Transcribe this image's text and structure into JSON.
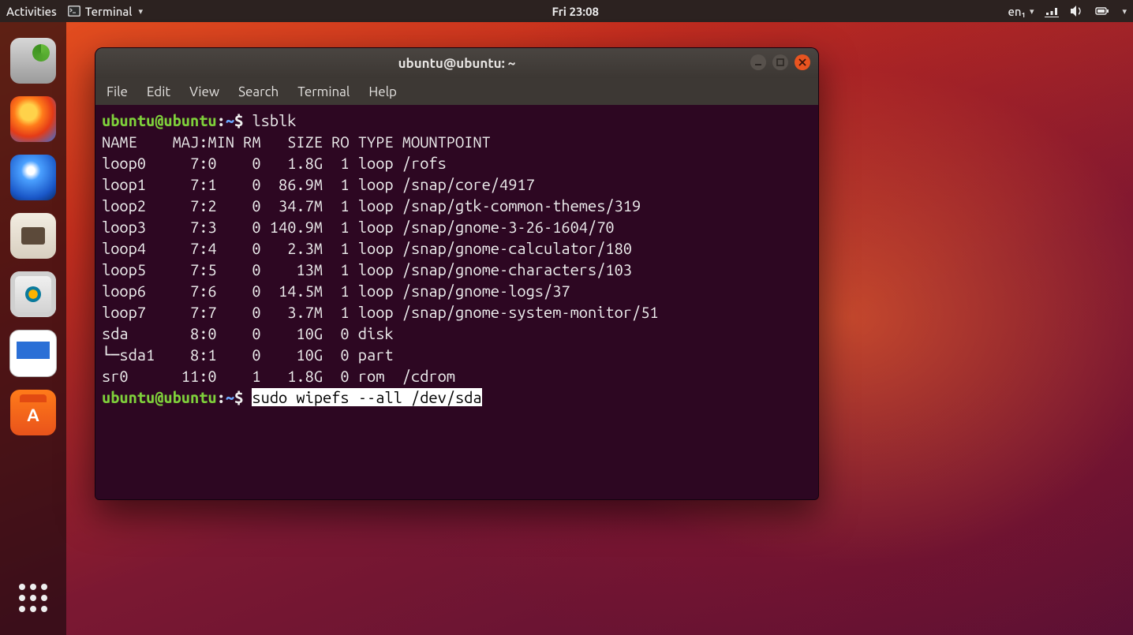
{
  "top_panel": {
    "activities": "Activities",
    "app_indicator": "Terminal",
    "clock": "Fri 23:08",
    "input_source": "en₁"
  },
  "dock": {
    "items": [
      "disks",
      "firefox",
      "thunderbird",
      "files",
      "rhythmbox",
      "writer",
      "software"
    ]
  },
  "window": {
    "title": "ubuntu@ubuntu: ~",
    "menus": {
      "file": "File",
      "edit": "Edit",
      "view": "View",
      "search": "Search",
      "terminal": "Terminal",
      "help": "Help"
    }
  },
  "terminal": {
    "prompt_user": "ubuntu",
    "prompt_host": "ubuntu",
    "prompt_path": "~",
    "prompt_sym": "$",
    "cmd1": "lsblk",
    "header": "NAME    MAJ:MIN RM   SIZE RO TYPE MOUNTPOINT",
    "rows": [
      "loop0     7:0    0   1.8G  1 loop /rofs",
      "loop1     7:1    0  86.9M  1 loop /snap/core/4917",
      "loop2     7:2    0  34.7M  1 loop /snap/gtk-common-themes/319",
      "loop3     7:3    0 140.9M  1 loop /snap/gnome-3-26-1604/70",
      "loop4     7:4    0   2.3M  1 loop /snap/gnome-calculator/180",
      "loop5     7:5    0    13M  1 loop /snap/gnome-characters/103",
      "loop6     7:6    0  14.5M  1 loop /snap/gnome-logs/37",
      "loop7     7:7    0   3.7M  1 loop /snap/gnome-system-monitor/51",
      "sda       8:0    0    10G  0 disk ",
      "└─sda1    8:1    0    10G  0 part ",
      "sr0      11:0    1   1.8G  0 rom  /cdrom"
    ],
    "cmd2": "sudo wipefs --all /dev/sda"
  }
}
